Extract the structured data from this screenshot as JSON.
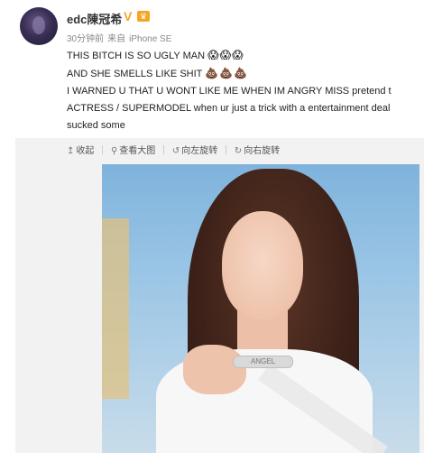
{
  "header": {
    "username": "edc陳冠希",
    "verified_badge": "V",
    "vip_badge": "♛",
    "time": "30分钟前",
    "source_prefix": "来自",
    "source_device": "iPhone SE"
  },
  "post": {
    "lines": [
      "THIS BITCH IS SO UGLY MAN",
      "AND SHE SMELLS LIKE SHIT",
      "I WARNED U THAT U WONT LIKE ME WHEN IM ANGRY MISS pretend t",
      "ACTRESS / SUPERMODEL when ur just a trick with a entertainment deal",
      "sucked some"
    ],
    "emoji_line1": "😱😱😱",
    "emoji_line2": "💩💩💩"
  },
  "toolbar": {
    "collapse_label": "收起",
    "view_large_label": "查看大图",
    "rotate_left_label": "向左旋转",
    "rotate_right_label": "向右旋转"
  },
  "photo": {
    "necklace_text": "ANGEL"
  }
}
